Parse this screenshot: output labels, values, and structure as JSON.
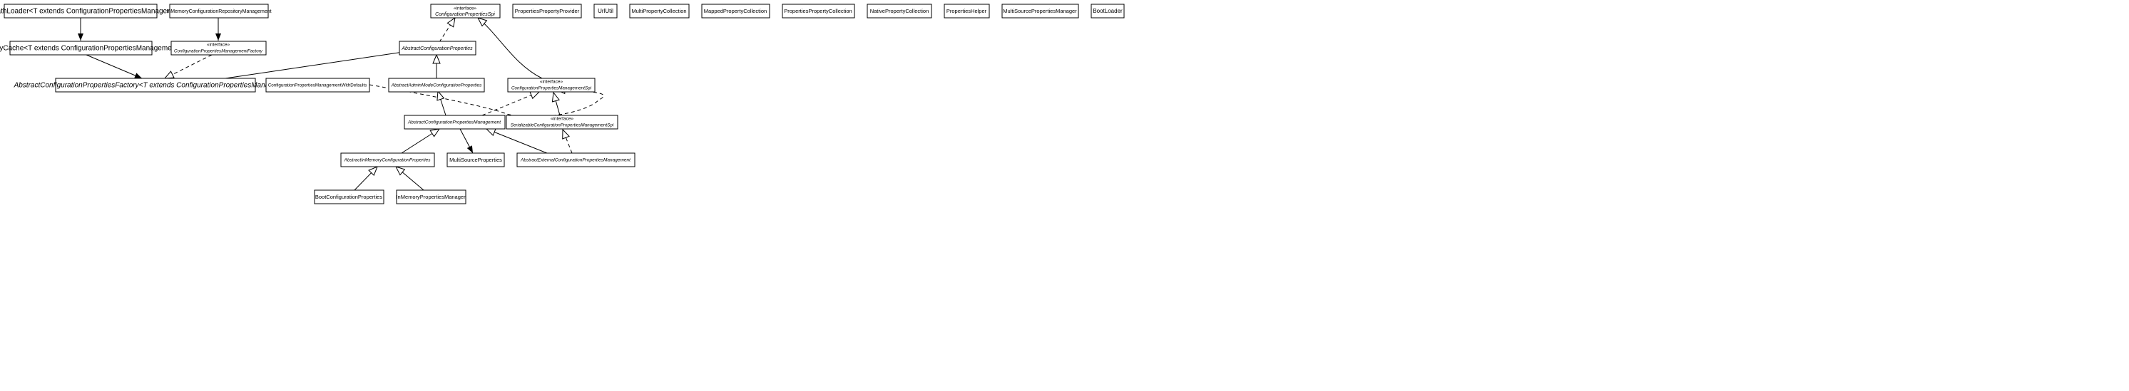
{
  "interface_tag": "«interface»",
  "nodes": {
    "ClassPathLoader": "ClassPathLoader<T extends ConfigurationPropertiesManagement>",
    "InMemoryConfigurationRepositoryManagement": "InMemoryConfigurationRepositoryManagement",
    "ConfigurationPropertiesSpi": "ConfigurationPropertiesSpi",
    "PropertiesPropertyProvider": "PropertiesPropertyProvider",
    "UrlUtil": "UrlUtil",
    "MultiPropertyCollection": "MultiPropertyCollection",
    "MappedPropertyCollection": "MappedPropertyCollection",
    "PropertiesPropertyCollection": "PropertiesPropertyCollection",
    "NativePropertyCollection": "NativePropertyCollection",
    "PropertiesHelper": "PropertiesHelper",
    "MultiSourcePropertiesManager": "MultiSourcePropertiesManager",
    "BootLoader": "BootLoader",
    "FactoryCache": "FactoryCache<T extends ConfigurationPropertiesManagement>",
    "ConfigurationPropertiesManagementFactory": "ConfigurationPropertiesManagementFactory",
    "AbstractConfigurationProperties": "AbstractConfigurationProperties",
    "AbstractConfigurationPropertiesFactory": "AbstractConfigurationPropertiesFactory<T extends ConfigurationPropertiesManagement>",
    "ConfigurationPropertiesManagementWithDefaults": "ConfigurationPropertiesManagementWithDefaults",
    "AbstractAdminModeConfigurationProperties": "AbstractAdminModeConfigurationProperties",
    "ConfigurationPropertiesManagementSpi": "ConfigurationPropertiesManagementSpi",
    "AbstractConfigurationPropertiesManagement": "AbstractConfigurationPropertiesManagement",
    "SerializableConfigurationPropertiesManagementSpi": "SerializableConfigurationPropertiesManagementSpi",
    "AbstractInMemoryConfigurationProperties": "AbstractInMemoryConfigurationProperties",
    "MultiSourceProperties": "MultiSourceProperties",
    "AbstractExternalConfigurationPropertiesManagement": "AbstractExternalConfigurationPropertiesManagement",
    "BootConfigurationProperties": "BootConfigurationProperties",
    "InMemoryPropertiesManager": "InMemoryPropertiesManager"
  },
  "chart_data": {
    "type": "uml_class_diagram",
    "relationships": [
      {
        "from": "ClassPathLoader",
        "to": "FactoryCache",
        "type": "association"
      },
      {
        "from": "InMemoryConfigurationRepositoryManagement",
        "to": "ConfigurationPropertiesManagementFactory",
        "type": "association"
      },
      {
        "from": "FactoryCache",
        "to": "AbstractConfigurationPropertiesFactory",
        "type": "association"
      },
      {
        "from": "ConfigurationPropertiesManagementFactory",
        "to": "AbstractConfigurationPropertiesFactory",
        "type": "realization"
      },
      {
        "from": "AbstractConfigurationProperties",
        "to": "ConfigurationPropertiesSpi",
        "type": "realization"
      },
      {
        "from": "AbstractAdminModeConfigurationProperties",
        "to": "AbstractConfigurationProperties",
        "type": "generalization"
      },
      {
        "from": "ConfigurationPropertiesManagementSpi",
        "to": "ConfigurationPropertiesSpi",
        "type": "generalization"
      },
      {
        "from": "AbstractConfigurationPropertiesFactory",
        "to": "AbstractConfigurationProperties",
        "type": "association"
      },
      {
        "from": "ConfigurationPropertiesManagementWithDefaults",
        "to": "ConfigurationPropertiesManagementSpi",
        "type": "realization"
      },
      {
        "from": "AbstractConfigurationPropertiesManagement",
        "to": "AbstractAdminModeConfigurationProperties",
        "type": "generalization"
      },
      {
        "from": "AbstractConfigurationPropertiesManagement",
        "to": "ConfigurationPropertiesManagementSpi",
        "type": "realization"
      },
      {
        "from": "SerializableConfigurationPropertiesManagementSpi",
        "to": "ConfigurationPropertiesManagementSpi",
        "type": "generalization"
      },
      {
        "from": "AbstractInMemoryConfigurationProperties",
        "to": "AbstractConfigurationPropertiesManagement",
        "type": "generalization"
      },
      {
        "from": "AbstractConfigurationPropertiesManagement",
        "to": "MultiSourceProperties",
        "type": "association"
      },
      {
        "from": "AbstractExternalConfigurationPropertiesManagement",
        "to": "AbstractConfigurationPropertiesManagement",
        "type": "generalization"
      },
      {
        "from": "AbstractExternalConfigurationPropertiesManagement",
        "to": "SerializableConfigurationPropertiesManagementSpi",
        "type": "realization"
      },
      {
        "from": "BootConfigurationProperties",
        "to": "AbstractInMemoryConfigurationProperties",
        "type": "generalization"
      },
      {
        "from": "InMemoryPropertiesManager",
        "to": "AbstractInMemoryConfigurationProperties",
        "type": "generalization"
      }
    ]
  }
}
